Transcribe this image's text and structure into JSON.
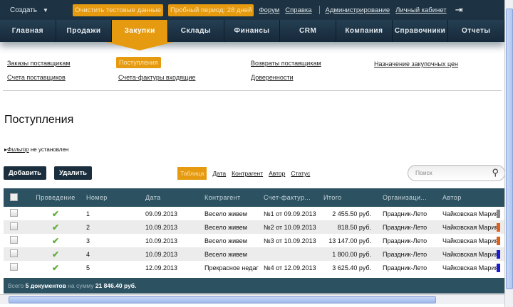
{
  "topbar": {
    "create": "Создать",
    "clear_test": "Очистить тестовые данные",
    "trial": "Пробный период: 28 дней",
    "forum": "Форум",
    "help": "Справка",
    "admin": "Администрирование",
    "cabinet": "Личный кабинет"
  },
  "nav": [
    "Главная",
    "Продажи",
    "Закупки",
    "Склады",
    "Финансы",
    "CRM",
    "Компания",
    "Справочники",
    "Отчеты"
  ],
  "subnav": {
    "orders": "Заказы поставщикам",
    "receipts": "Поступления",
    "returns": "Возвраты поставщикам",
    "prices": "Назначение закупочных цен",
    "invoices": "Счета поставщиков",
    "tax_invoices": "Счета-фактуры входящие",
    "proxies": "Доверенности"
  },
  "page_title": "Поступления",
  "filter": {
    "label": "Фильтр",
    "status": "не установлен"
  },
  "buttons": {
    "add": "Добавить",
    "delete": "Удалить"
  },
  "views": [
    "Таблица",
    "Дата",
    "Контрагент",
    "Автор",
    "Статус"
  ],
  "search_placeholder": "Поиск",
  "columns": [
    "Проведение",
    "Номер",
    "Дата",
    "Контрагент",
    "Счет-фактур...",
    "Итого",
    "Организаци...",
    "Автор"
  ],
  "rows": [
    {
      "num": "1",
      "date": "09.09.2013",
      "party": "Весело живем",
      "invoice": "№1 от 09.09.2013",
      "total": "2 455.50 руб.",
      "org": "Праздник-Лето",
      "author": "Чайковская Мария",
      "color": "#888888"
    },
    {
      "num": "2",
      "date": "10.09.2013",
      "party": "Весело живем",
      "invoice": "№2 от 10.09.2013",
      "total": "818.50 руб.",
      "org": "Праздник-Лето",
      "author": "Чайковская Мария",
      "color": "#e0601a"
    },
    {
      "num": "3",
      "date": "10.09.2013",
      "party": "Весело живем",
      "invoice": "№3 от 10.09.2013",
      "total": "13 147.00 руб.",
      "org": "Праздник-Лето",
      "author": "Чайковская Мария",
      "color": "#e0601a"
    },
    {
      "num": "4",
      "date": "10.09.2013",
      "party": "Весело живем",
      "invoice": "",
      "total": "1 800.00 руб.",
      "org": "Праздник-Лето",
      "author": "Чайковская Мария",
      "color": "#1a1ad0"
    },
    {
      "num": "5",
      "date": "12.09.2013",
      "party": "Прекрасное недаг",
      "invoice": "№4 от 12.09.2013",
      "total": "3 625.40 руб.",
      "org": "Праздник-Лето",
      "author": "Чайковская Мария",
      "color": "#1a1ad0"
    }
  ],
  "footer": {
    "prefix": "Всего",
    "count": "5 документов",
    "mid": "на сумму",
    "sum": "21 846.40 руб."
  }
}
